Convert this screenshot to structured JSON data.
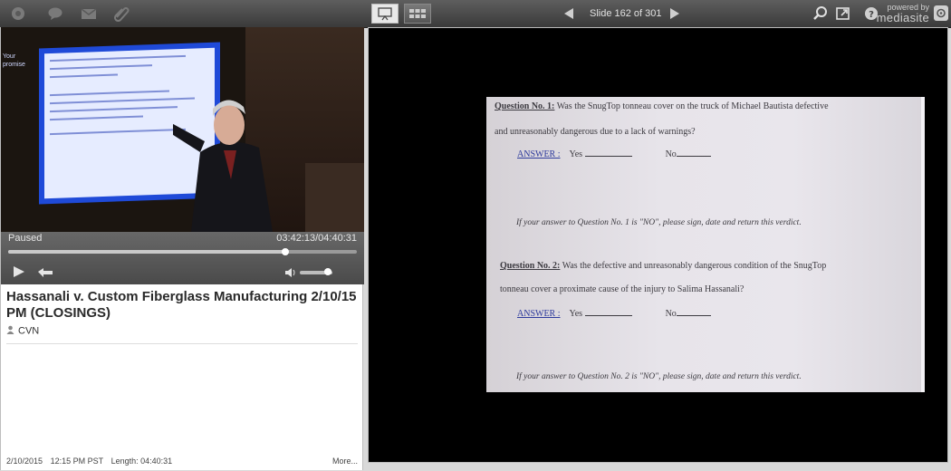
{
  "toolbar": {
    "left_icons": [
      "home-icon",
      "comment-icon",
      "mail-icon",
      "link-icon"
    ],
    "view_modes": [
      "slide-view-icon",
      "grid-view-icon"
    ],
    "slide_counter": "Slide 162 of 301",
    "powered_by": "powered by",
    "brand": "mediasite",
    "right_icons": [
      "search-icon",
      "popout-icon",
      "help-icon",
      "mediasite-logo-icon"
    ]
  },
  "player": {
    "status": "Paused",
    "timecode": "03:42:13/04:40:31",
    "progress_fraction": 0.795,
    "volume_fraction": 0.85,
    "video_screen_text": "Your\npromise"
  },
  "presentation": {
    "title": "Hassanali v. Custom Fiberglass Manufacturing 2/10/15 PM (CLOSINGS)",
    "presenter": "CVN",
    "date": "2/10/2015",
    "time": "12:15 PM PST",
    "length": "Length: 04:40:31",
    "more_label": "More..."
  },
  "slide": {
    "q1_label": "Question No. 1:",
    "q1_line1": "Was the SnugTop tonneau cover on the truck of Michael Bautista defective",
    "q1_line2": "and unreasonably dangerous due to a lack of warnings?",
    "answer_label": "ANSWER :",
    "yes_label": "Yes",
    "no_label": "No",
    "q1_note": "If your answer to Question No. 1 is \"NO\", please sign, date and return this verdict.",
    "q2_label": "Question No. 2:",
    "q2_line1": "Was the defective and unreasonably dangerous condition of the SnugTop",
    "q2_line2": "tonneau cover a proximate cause of the injury to Salima Hassanali?",
    "q2_note": "If your answer to Question No. 2 is \"NO\", please sign, date and return this verdict."
  },
  "colors": {
    "toolbar": "#4a4a4a",
    "slide_bg": "#e7e4ea",
    "answer_link": "#2d3a9c"
  }
}
